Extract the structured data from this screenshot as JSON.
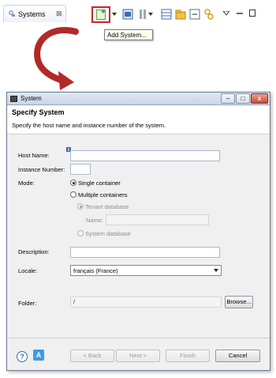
{
  "view": {
    "tab_title": "Systems",
    "tab_close": "⊠"
  },
  "toolbar": {
    "tooltip": "Add System..."
  },
  "dialog": {
    "title": "System",
    "header_title": "Specify System",
    "header_description": "Specify the host name and instance number of the system.",
    "fields": {
      "host_name_label": "Host Name:",
      "host_name_value": "",
      "instance_number_label": "Instance Number:",
      "instance_number_value": "",
      "mode_label": "Mode:",
      "mode_single": "Single container",
      "mode_multiple": "Multiple containers",
      "tenant_database": "Tenant database",
      "name_label": "Name:",
      "name_value": "",
      "system_database": "System database",
      "description_label": "Description:",
      "description_value": "",
      "locale_label": "Locale:",
      "locale_value": "français (France)",
      "folder_label": "Folder:",
      "folder_value": "/"
    },
    "buttons": {
      "browse": "Browse...",
      "back": "< Back",
      "next": "Next >",
      "finish": "Finish",
      "cancel": "Cancel"
    },
    "icons": {
      "help": "?",
      "tips": "A"
    },
    "selected_mode": "single-container"
  }
}
